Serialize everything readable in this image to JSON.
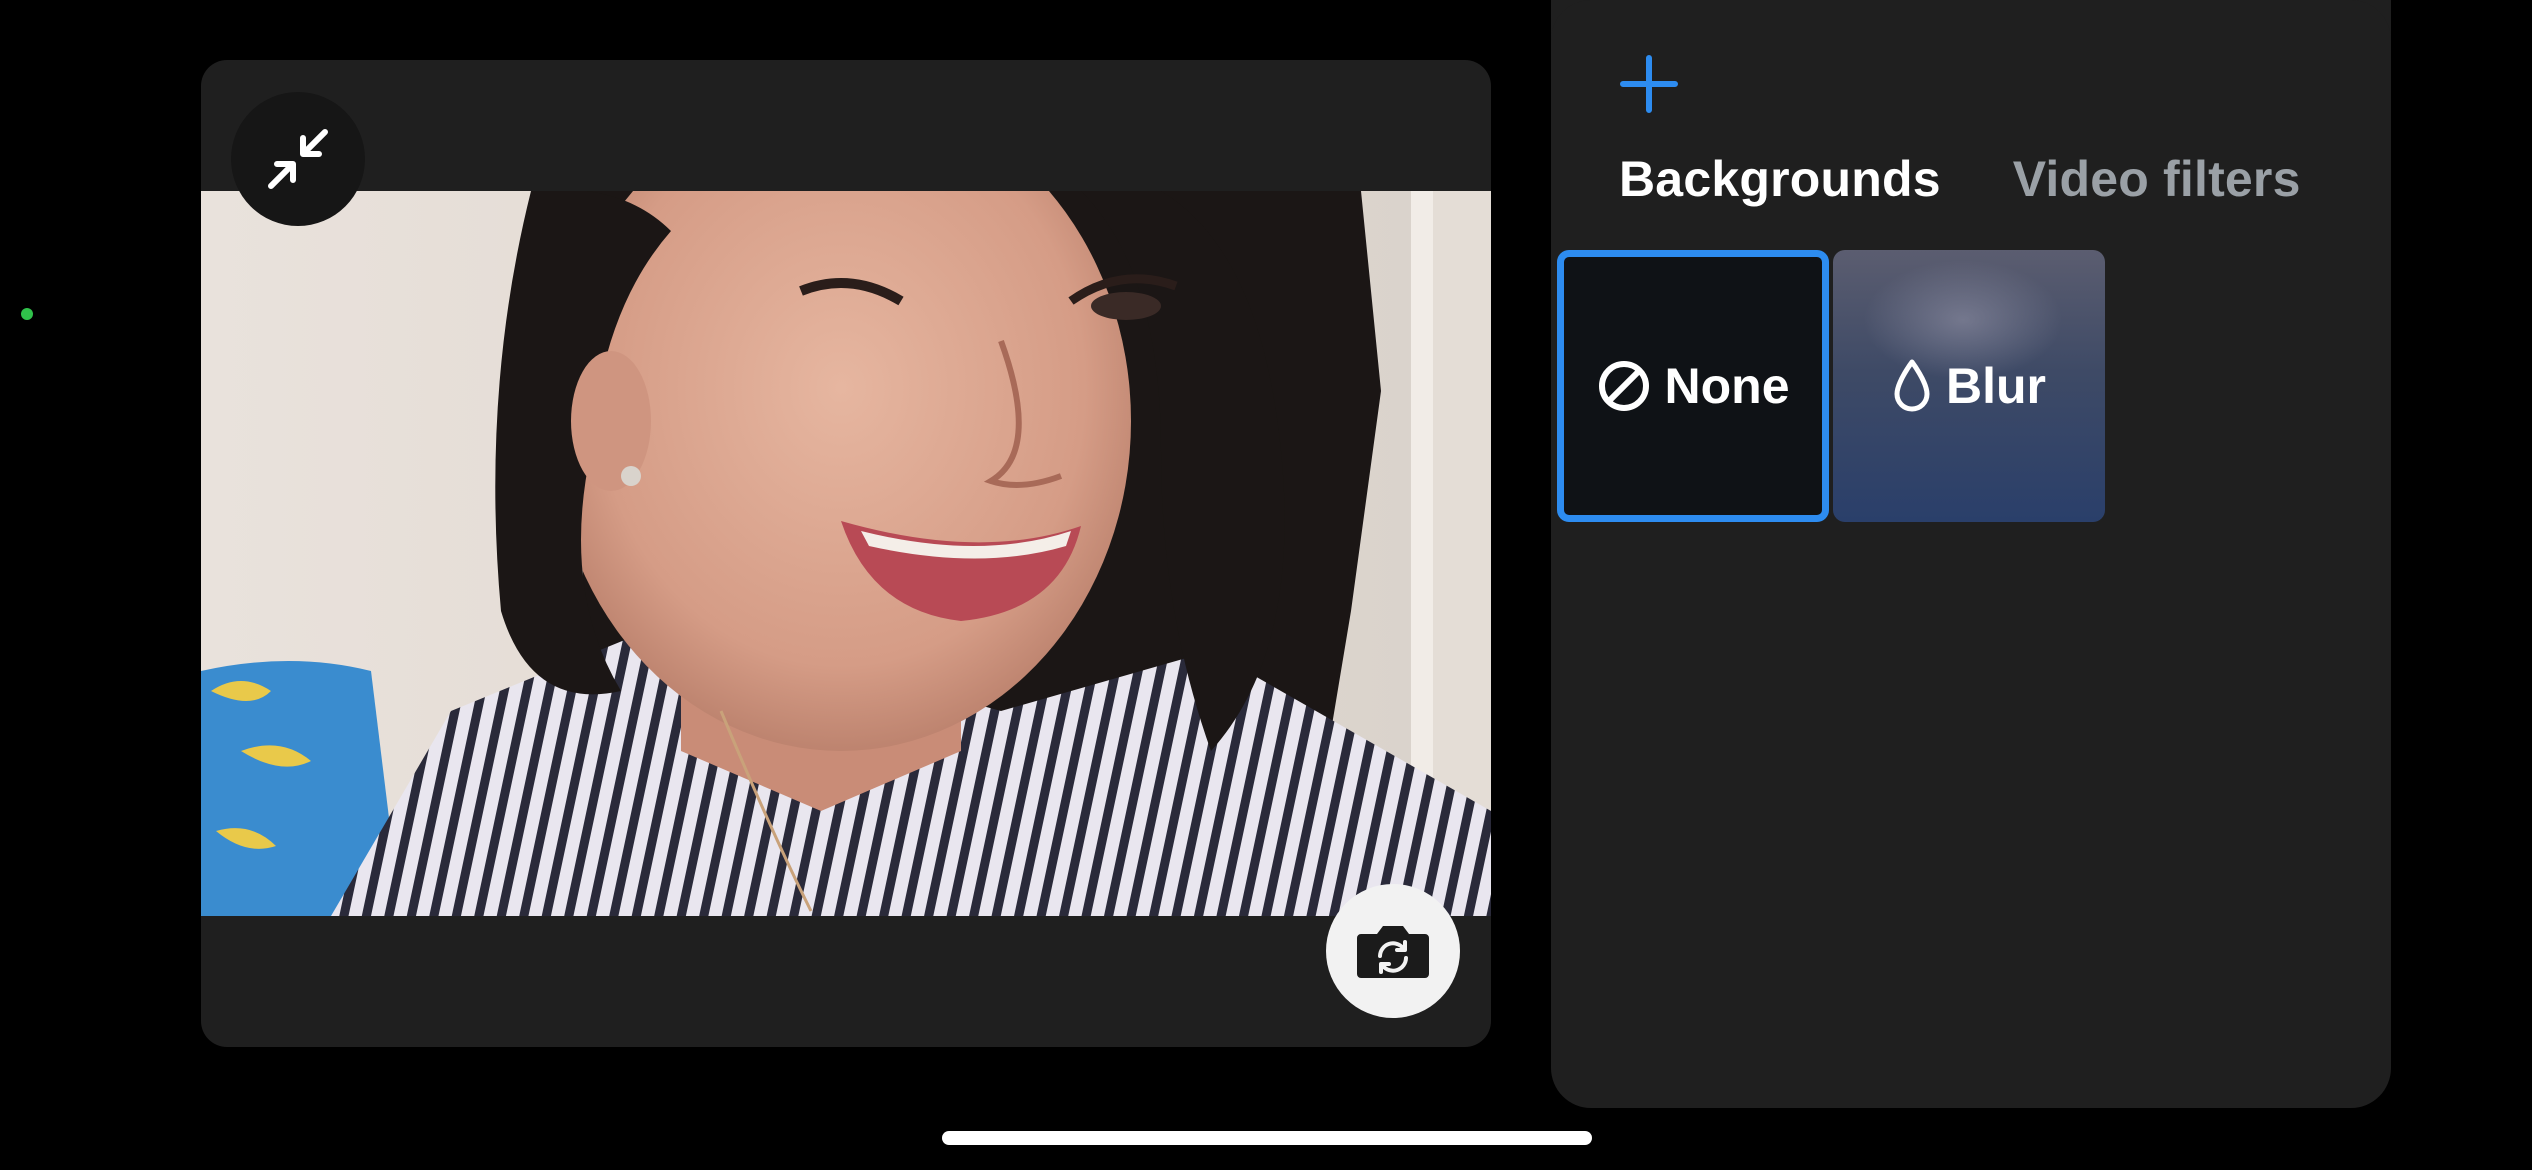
{
  "preview": {
    "minimize_icon": "minimize-arrows-icon",
    "flip_camera_icon": "camera-flip-icon"
  },
  "effects": {
    "add_icon": "plus-icon",
    "accent_color": "#2d8cf0",
    "tabs": [
      {
        "label": "Backgrounds",
        "active": true
      },
      {
        "label": "Video filters",
        "active": false
      }
    ],
    "options": [
      {
        "label": "None",
        "icon": "prohibited-icon",
        "selected": true
      },
      {
        "label": "Blur",
        "icon": "droplet-icon",
        "selected": false
      }
    ]
  }
}
